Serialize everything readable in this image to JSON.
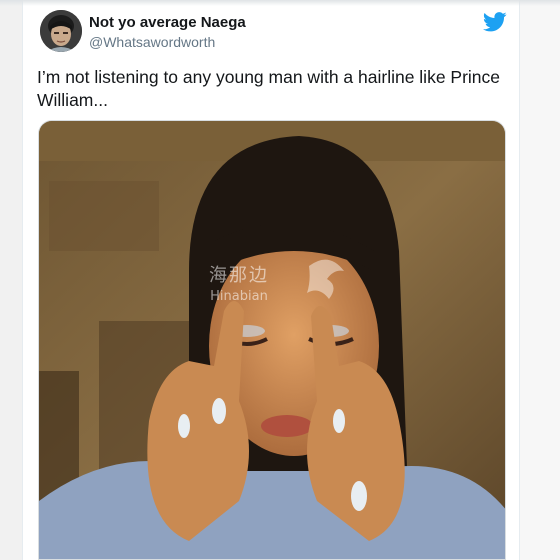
{
  "tweet": {
    "display_name": "Not yo average Naega",
    "handle": "@Whatsawordworth",
    "text": "I’m not listening to any young man with a hairline like Prince William..."
  },
  "watermark": {
    "cn": "海那边",
    "en": "Hinabian"
  },
  "colors": {
    "twitter_blue": "#1da1f2",
    "name_text": "#14171a",
    "handle_text": "#657786"
  },
  "icons": {
    "logo": "twitter-bird-icon"
  }
}
